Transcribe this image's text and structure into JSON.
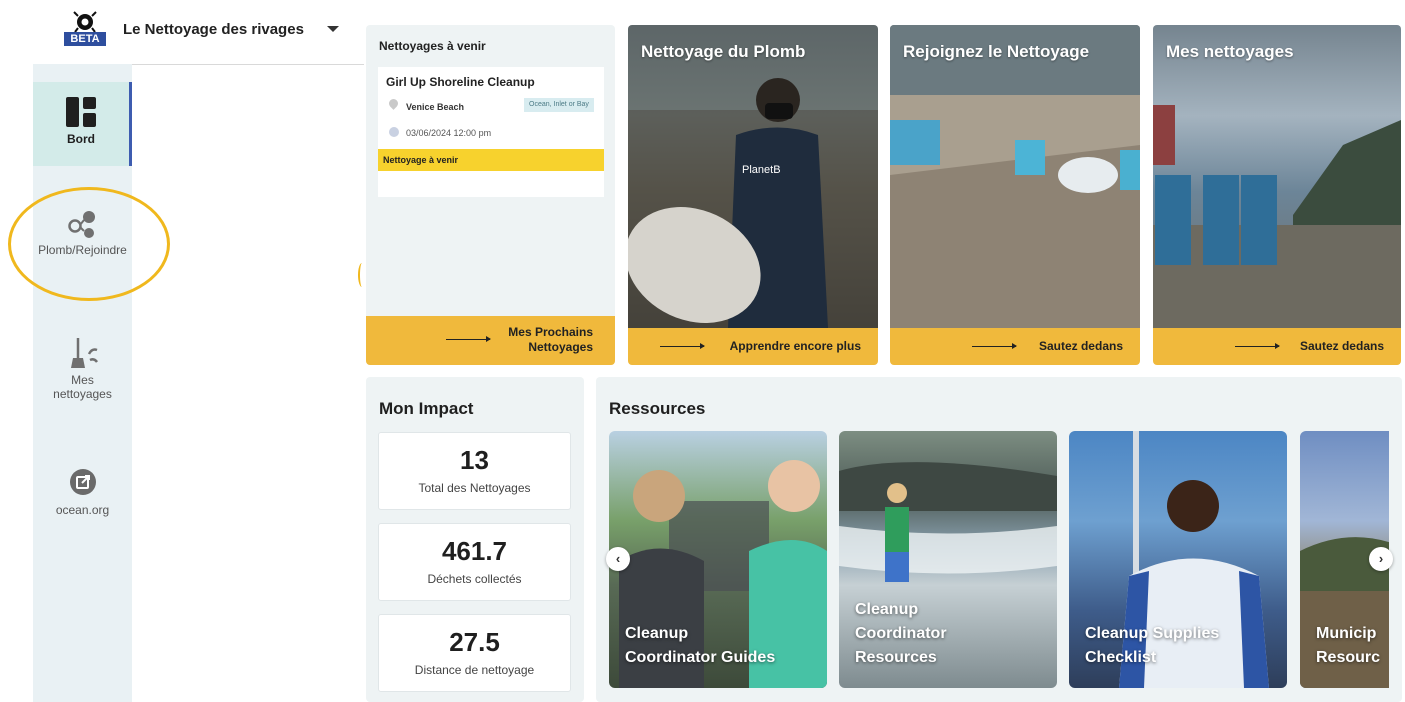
{
  "header": {
    "badge": "BETA",
    "org_name": "Le Nettoyage des rivages"
  },
  "sidebar": {
    "items": [
      {
        "label": "Bord",
        "icon": "dashboard-icon",
        "active": true
      },
      {
        "label": "Plomb/Rejoindre",
        "icon": "lead-join-icon",
        "active": false
      },
      {
        "label": "Mes nettoyages",
        "icon": "broom-icon",
        "active": false
      },
      {
        "label": "ocean.org",
        "icon": "external-link-icon",
        "active": false
      }
    ]
  },
  "upcoming": {
    "title": "Nettoyages à venir",
    "event": {
      "name": "Girl Up Shoreline Cleanup",
      "location": "Venice Beach",
      "environment": "Ocean, Inlet or Bay",
      "datetime": "03/06/2024 12:00 pm",
      "status": "Nettoyage à venir"
    },
    "footer_line1": "Mes Prochains",
    "footer_line2": "Nettoyages"
  },
  "action_cards": [
    {
      "title": "Nettoyage du Plomb",
      "cta": "Apprendre encore plus"
    },
    {
      "title": "Rejoignez le Nettoyage",
      "cta": "Sautez dedans"
    },
    {
      "title": "Mes nettoyages",
      "cta": "Sautez dedans"
    }
  ],
  "impact": {
    "title": "Mon Impact",
    "stats": [
      {
        "value": "13",
        "label": "Total des Nettoyages"
      },
      {
        "value": "461.7",
        "label": "Déchets collectés"
      },
      {
        "value": "27.5",
        "label": "Distance de nettoyage"
      }
    ]
  },
  "resources": {
    "title": "Ressources",
    "tiles": [
      {
        "line1": "Cleanup",
        "line2": "Coordinator Guides"
      },
      {
        "line1": "Cleanup",
        "line2": "Coordinator",
        "line3": "Resources"
      },
      {
        "line1": "Cleanup Supplies",
        "line2": "Checklist"
      },
      {
        "line1": "Municip",
        "line2": "Resourc"
      }
    ],
    "prev": "‹",
    "next": "›"
  },
  "colors": {
    "accent_yellow": "#f0b93c",
    "status_yellow": "#f7d22d",
    "panel_bg": "#eef3f4",
    "sidebar_bg": "#e9f1f4",
    "active_border": "#3d5cb0",
    "beta_blue": "#2e4e9e",
    "highlight_ring": "#f0b81d"
  }
}
